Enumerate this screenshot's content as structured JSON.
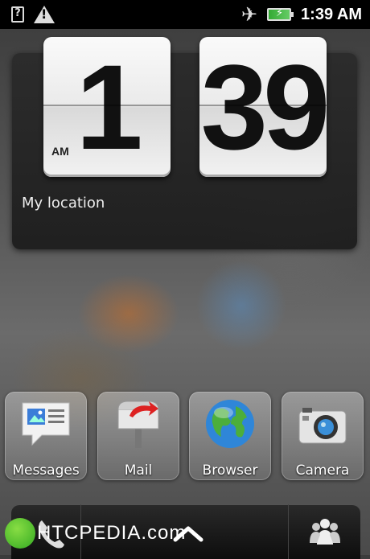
{
  "status_bar": {
    "sd_symbol": "?",
    "time": "1:39 AM",
    "icons": [
      "sd-card-icon",
      "warning-icon",
      "airplane-mode-icon",
      "battery-charging-icon"
    ]
  },
  "clock_widget": {
    "hours": "1",
    "minutes": "39",
    "ampm": "AM",
    "location": "My location"
  },
  "apps": [
    {
      "label": "Messages",
      "icon": "messages-icon"
    },
    {
      "label": "Mail",
      "icon": "mail-icon"
    },
    {
      "label": "Browser",
      "icon": "browser-icon"
    },
    {
      "label": "Camera",
      "icon": "camera-icon"
    }
  ],
  "dock": {
    "icons": [
      "phone-icon",
      "all-apps-up-icon",
      "people-icon"
    ]
  },
  "watermark": {
    "text": "HTCPEDIA.com"
  },
  "colors": {
    "status_bar": "#000000",
    "battery_fill": "#33aa33"
  }
}
